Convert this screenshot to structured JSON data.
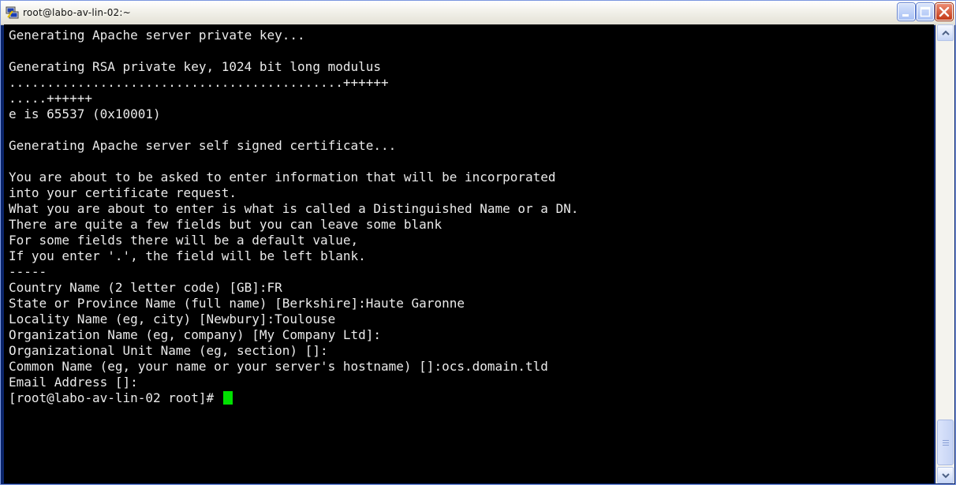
{
  "window": {
    "title": "root@labo-av-lin-02:~",
    "app_icon": "putty-icon"
  },
  "controls": {
    "minimize_icon": "minimize-icon",
    "maximize_icon": "maximize-icon",
    "close_icon": "close-icon"
  },
  "colors": {
    "terminal_bg": "#000000",
    "terminal_fg": "#eaeaea",
    "cursor": "#00e000"
  },
  "terminal": {
    "lines": [
      "Generating Apache server private key...",
      "",
      "Generating RSA private key, 1024 bit long modulus",
      "............................................++++++",
      ".....++++++",
      "e is 65537 (0x10001)",
      "",
      "Generating Apache server self signed certificate...",
      "",
      "You are about to be asked to enter information that will be incorporated",
      "into your certificate request.",
      "What you are about to enter is what is called a Distinguished Name or a DN.",
      "There are quite a few fields but you can leave some blank",
      "For some fields there will be a default value,",
      "If you enter '.', the field will be left blank.",
      "-----",
      "Country Name (2 letter code) [GB]:FR",
      "State or Province Name (full name) [Berkshire]:Haute Garonne",
      "Locality Name (eg, city) [Newbury]:Toulouse",
      "Organization Name (eg, company) [My Company Ltd]:",
      "Organizational Unit Name (eg, section) []:",
      "Common Name (eg, your name or your server's hostname) []:ocs.domain.tld",
      "Email Address []:"
    ],
    "prompt": "[root@labo-av-lin-02 root]# "
  }
}
